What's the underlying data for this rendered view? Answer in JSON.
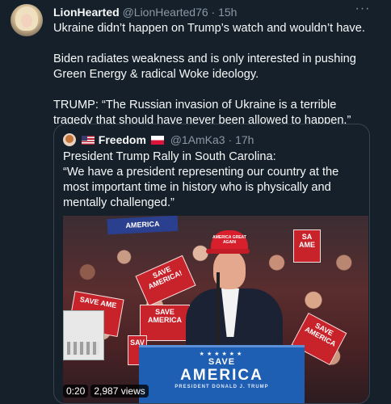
{
  "tweet": {
    "name": "LionHearted",
    "handle": "@LionHearted76",
    "separator": "·",
    "time": "15h",
    "more_label": "···",
    "text": [
      "Ukraine didn’t happen on Trump’s watch and wouldn’t have.",
      "Biden radiates weakness and is only interested in pushing Green Energy & radical Woke ideology.",
      "TRUMP: “The Russian invasion of Ukraine is a terrible tragedy that should have never been allowed to happen.”"
    ]
  },
  "quoted": {
    "name": "Freedom",
    "handle": "@1AmKa3",
    "separator": "·",
    "time": "17h",
    "text": "President Trump Rally in South Carolina:\n“We have a president representing our country at the most important time in history who is physically and mentally challenged.”",
    "video": {
      "duration": "0:20",
      "views": "2,987 views",
      "signs": [
        "AMERICA",
        "SAVE AMERICA!",
        "SA AME",
        "SAVE AME",
        "SAVE AMERICA",
        "SAVE AMERICA",
        "SAV"
      ],
      "cap_text": "AMERICA GREAT AGAIN",
      "podium": {
        "line1": "SAVE",
        "line2": "AMERICA",
        "line3": "PRESIDENT DONALD J. TRUMP",
        "stars": "★★★★★★"
      }
    }
  },
  "colors": {
    "background": "#15202b",
    "text_primary": "#f7f9f9",
    "text_secondary": "#8b98a5",
    "border": "#38444d"
  }
}
